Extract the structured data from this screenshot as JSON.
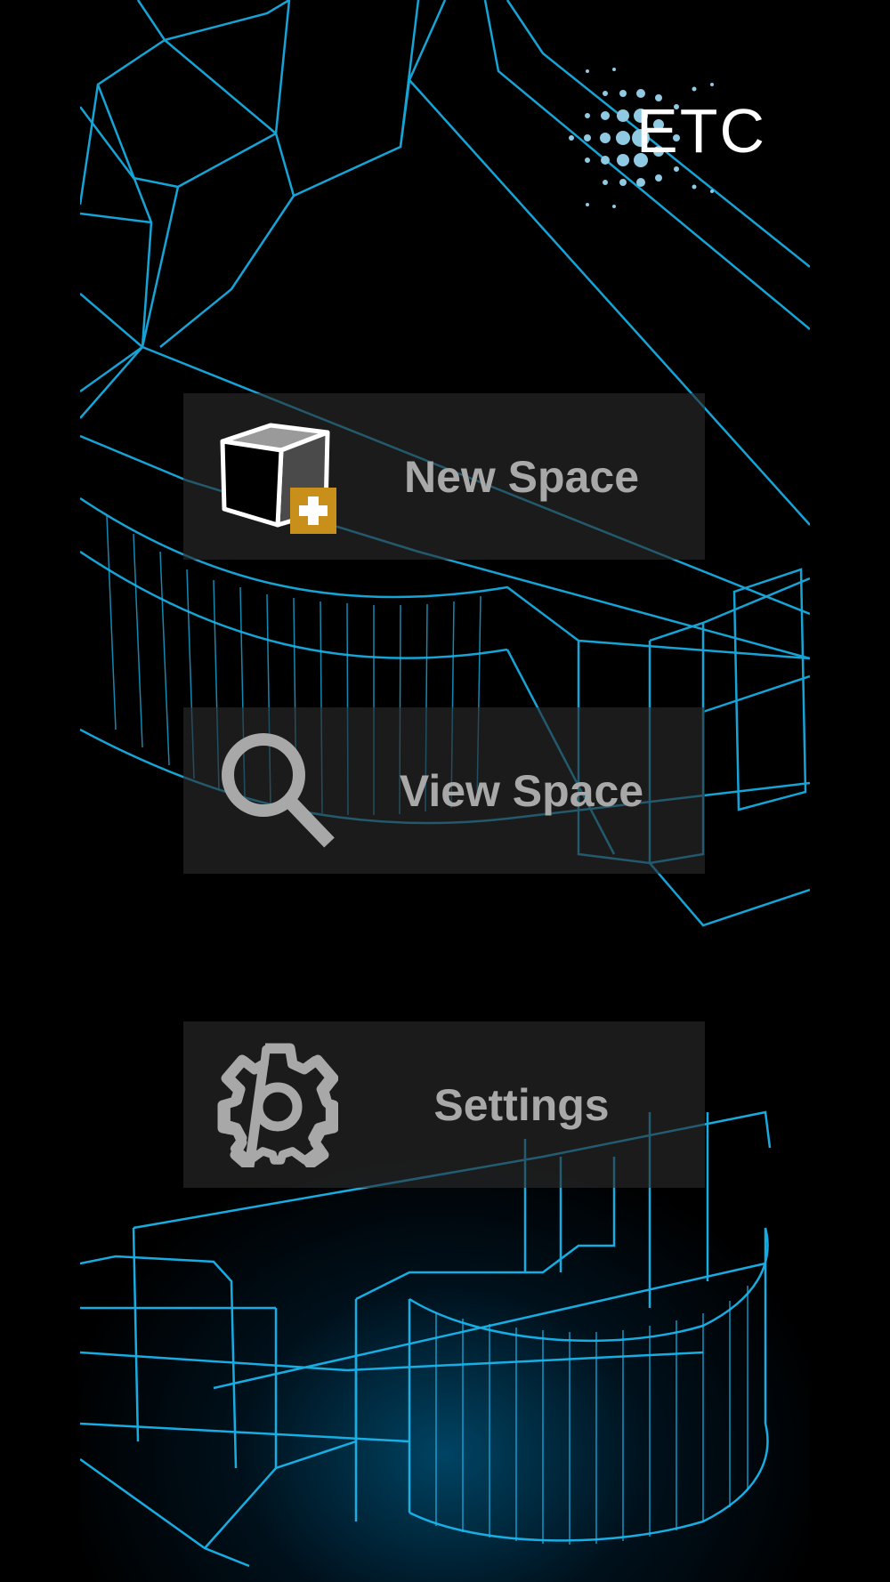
{
  "logo": {
    "text": "ETC",
    "icon": "etc-dot-logo"
  },
  "buttons": [
    {
      "label": "New Space",
      "icon": "cube-plus-icon"
    },
    {
      "label": "View Space",
      "icon": "magnifier-icon"
    },
    {
      "label": "Settings",
      "icon": "gear-icon"
    }
  ],
  "colors": {
    "wireframe": "#19b6ee",
    "accent": "#c8901a",
    "button_text": "#a8a8a8",
    "background": "#000000"
  }
}
